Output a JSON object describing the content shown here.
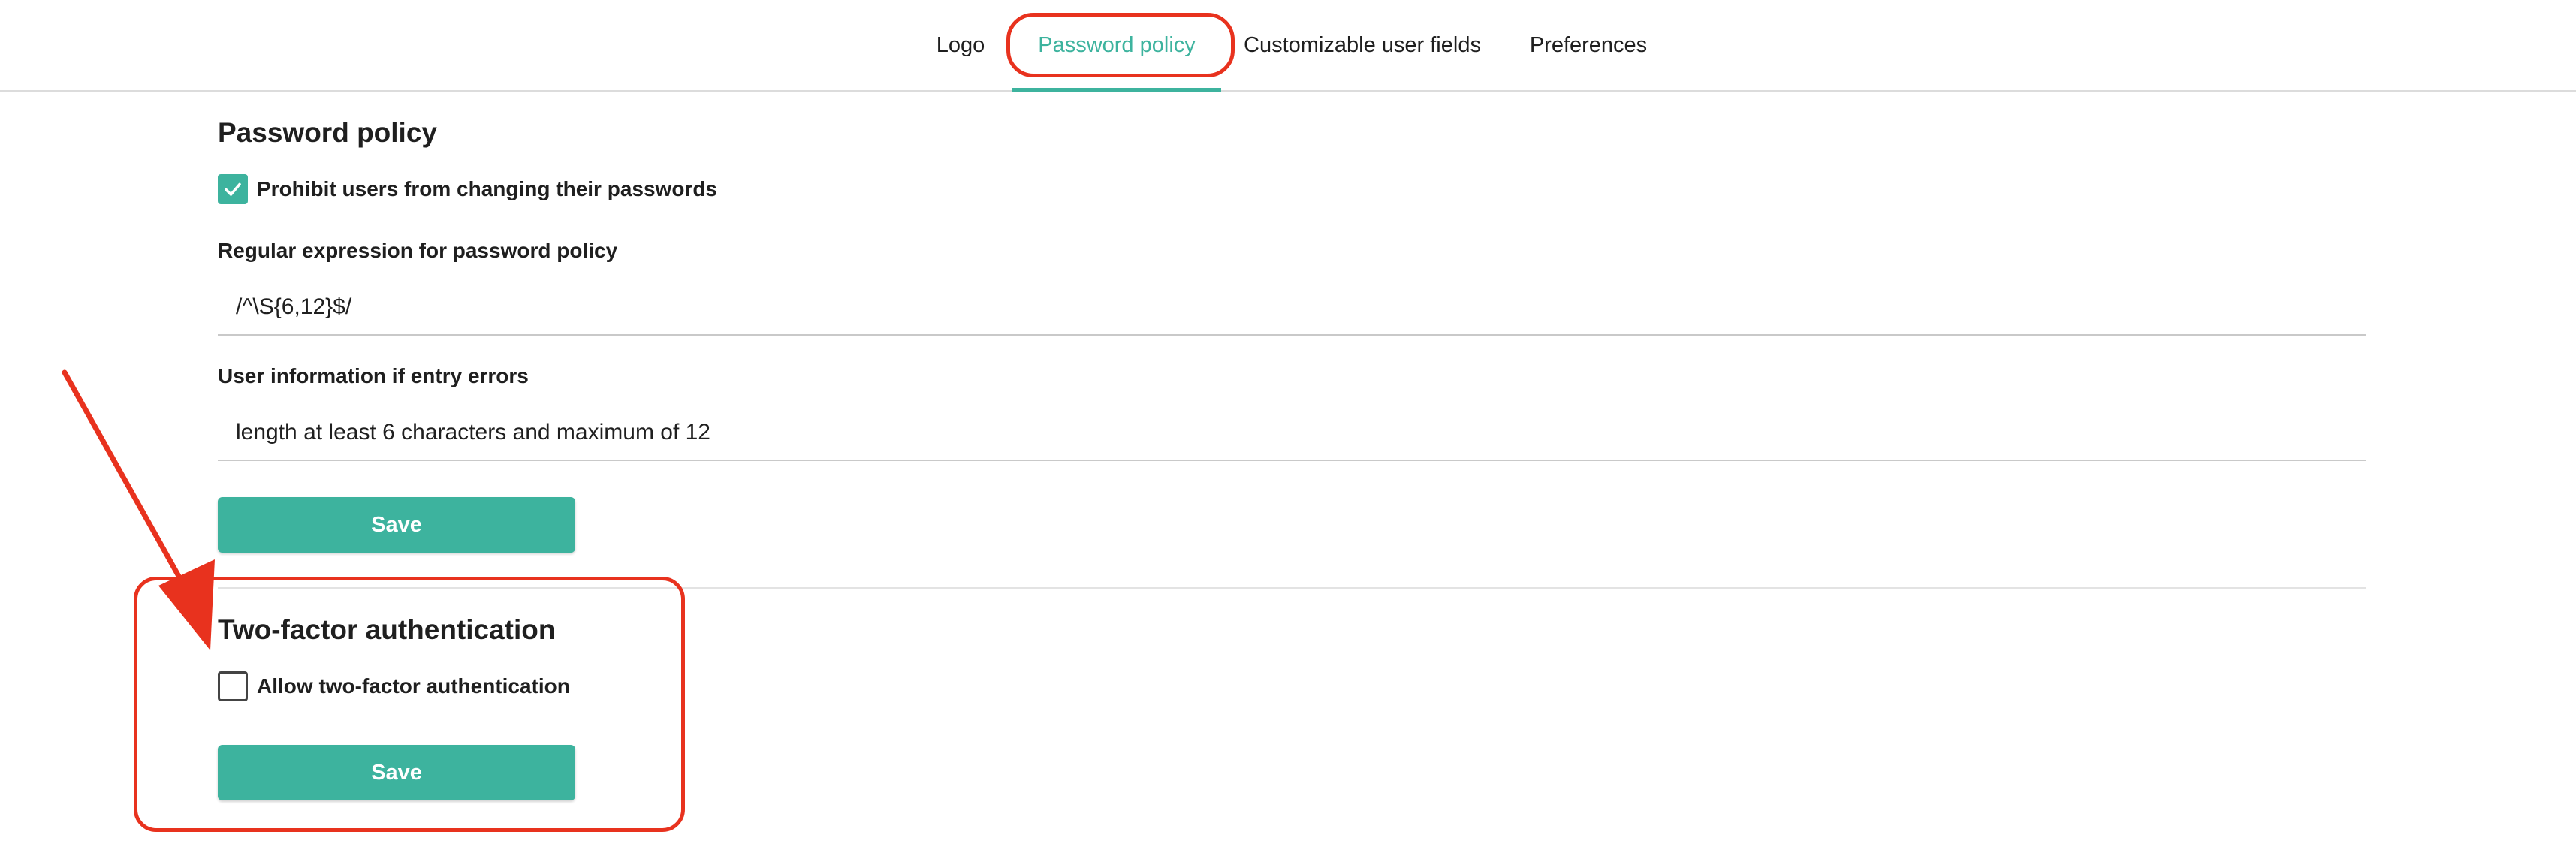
{
  "tabs": {
    "logo": "Logo",
    "password_policy": "Password policy",
    "custom_fields": "Customizable user fields",
    "preferences": "Preferences",
    "active": "password_policy"
  },
  "password_policy": {
    "title": "Password policy",
    "prohibit_change": {
      "label": "Prohibit users from changing their passwords",
      "checked": true
    },
    "regex": {
      "label": "Regular expression for password policy",
      "value": "/^\\S{6,12}$/"
    },
    "error_info": {
      "label": "User information if entry errors",
      "value": "length at least 6 characters and maximum of 12"
    },
    "save_label": "Save"
  },
  "two_factor": {
    "title": "Two-factor authentication",
    "allow": {
      "label": "Allow two-factor authentication",
      "checked": false
    },
    "save_label": "Save"
  },
  "colors": {
    "accent": "#3db39e",
    "annotation": "#e8321e",
    "text": "#1f1f1f"
  },
  "icons": {
    "checkbox_checked": "checkmark-icon",
    "annotation_arrow": "arrow-icon"
  }
}
